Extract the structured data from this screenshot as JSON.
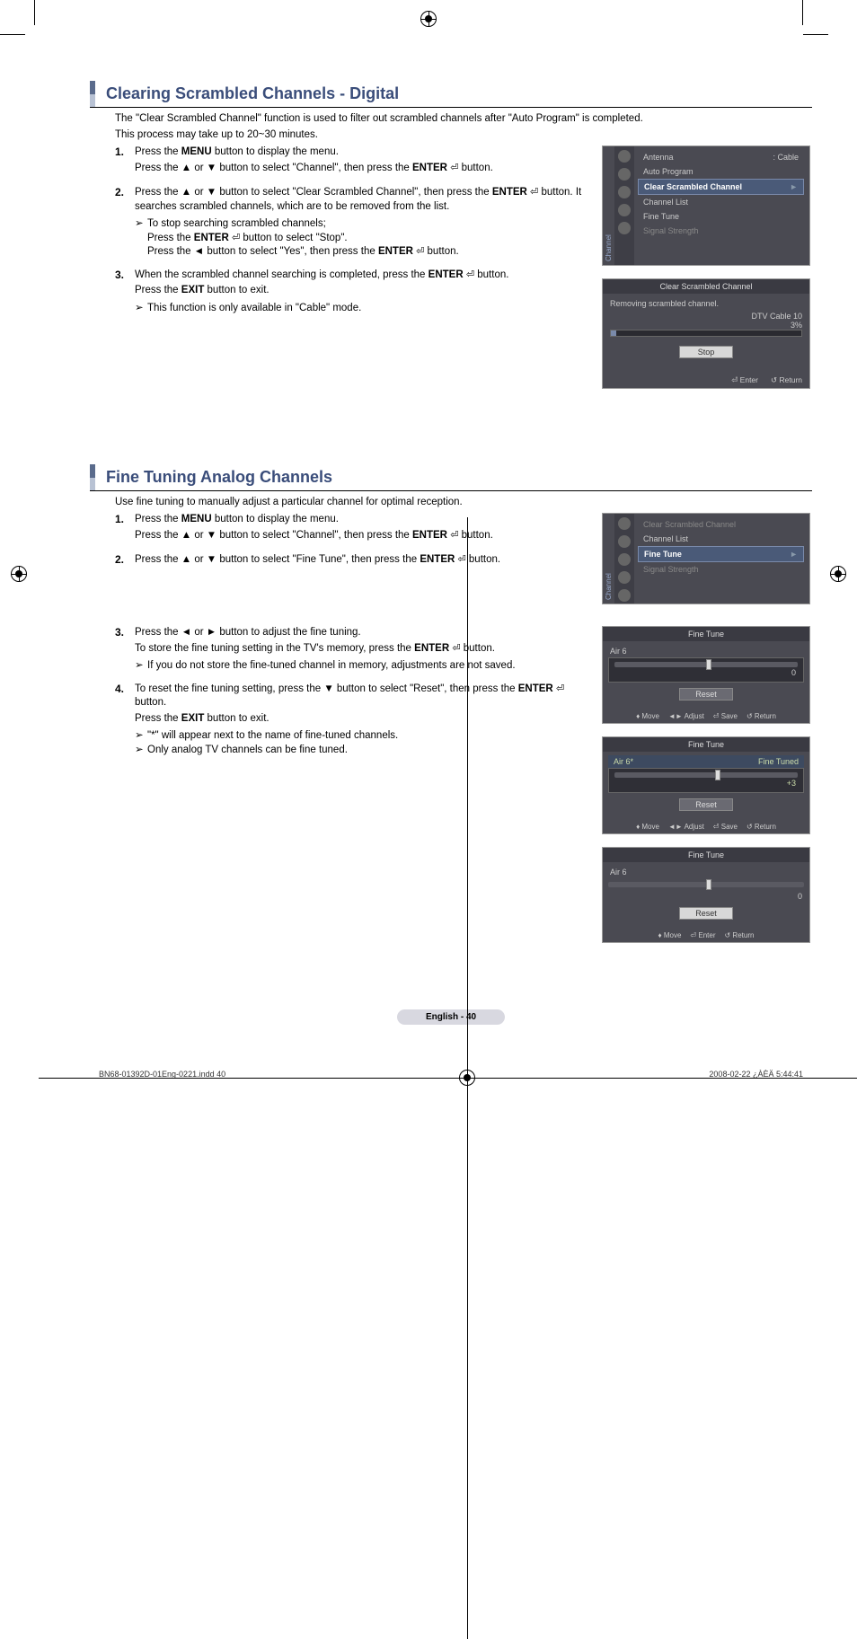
{
  "section1": {
    "title": "Clearing Scrambled Channels - Digital",
    "intro1": "The \"Clear Scrambled Channel\" function is used to filter out scrambled channels after \"Auto Program\" is completed.",
    "intro2": "This process may take up to 20~30 minutes.",
    "steps": {
      "s1a": "Press the ",
      "s1b": " button to display the menu.",
      "s1c": "Press the ▲ or ▼ button to select \"Channel\", then press the ",
      "s1d": " button.",
      "s2a": "Press the ▲ or ▼ button to select \"Clear Scrambled Channel\", then press the ",
      "s2b": " button. It searches scrambled channels, which are to be removed from the list.",
      "s2sub1": "To stop searching scrambled channels;",
      "s2sub2a": "Press the ",
      "s2sub2b": " button to select \"Stop\".",
      "s2sub3a": "Press the ◄ button to select \"Yes\", then press the ",
      "s2sub3b": " button.",
      "s3a": "When the scrambled channel searching is completed, press the ",
      "s3b": " button.",
      "s3c": "Press the ",
      "s3d": " button to exit.",
      "s3sub": "This function is only available in \"Cable\" mode."
    },
    "menu": "MENU",
    "enter": "ENTER",
    "exit": "EXIT"
  },
  "osd1": {
    "vert": "Channel",
    "antenna": "Antenna",
    "cable": ": Cable",
    "auto": "Auto Program",
    "clear": "Clear Scrambled Channel",
    "list": "Channel List",
    "fine": "Fine Tune",
    "signal": "Signal Strength"
  },
  "dlg": {
    "title": "Clear Scrambled Channel",
    "status": "Removing scrambled channel.",
    "ch": "DTV Cable 10",
    "pct": "3%",
    "stop": "Stop",
    "enter": "Enter",
    "return": "Return"
  },
  "section2": {
    "title": "Fine Tuning Analog Channels",
    "intro": "Use fine tuning to manually adjust a particular channel for optimal reception.",
    "steps": {
      "s1a": "Press the ",
      "s1b": " button to display the menu.",
      "s1c": "Press the ▲ or ▼ button to select \"Channel\", then press the ",
      "s1d": " button.",
      "s2a": "Press the ▲ or ▼ button to select \"Fine Tune\", then press the ",
      "s2b": " button.",
      "s3a": "Press the ◄ or ► button to adjust the fine tuning.",
      "s3b": "To store the fine tuning setting in the TV's memory, press the ",
      "s3c": " button.",
      "s3sub": "If you do not store the fine-tuned channel in memory, adjustments are not saved.",
      "s4a": "To reset the fine tuning setting, press the ▼ button to select \"Reset\", then press  the ",
      "s4b": " button.",
      "s4c": "Press the ",
      "s4d": " button to exit.",
      "s4sub1": "\"*\" will appear next to the name of fine-tuned channels.",
      "s4sub2": "Only analog TV channels can be fine tuned."
    }
  },
  "osd2": {
    "vert": "Channel",
    "clear": "Clear Scrambled Channel",
    "list": "Channel List",
    "fine": "Fine Tune",
    "signal": "Signal Strength"
  },
  "ft": {
    "title": "Fine Tune",
    "air6": "Air 6",
    "air6s": "Air 6*",
    "tuned": "Fine Tuned",
    "val0": "0",
    "valp3": "+3",
    "reset": "Reset",
    "move": "Move",
    "adjust": "Adjust",
    "save": "Save",
    "enter": "Enter",
    "return": "Return"
  },
  "footer": {
    "page": "English - 40",
    "file": "BN68-01392D-01Eng-0221.indd   40",
    "date": "2008-02-22   ¿ÀÈÄ 5:44:41"
  }
}
